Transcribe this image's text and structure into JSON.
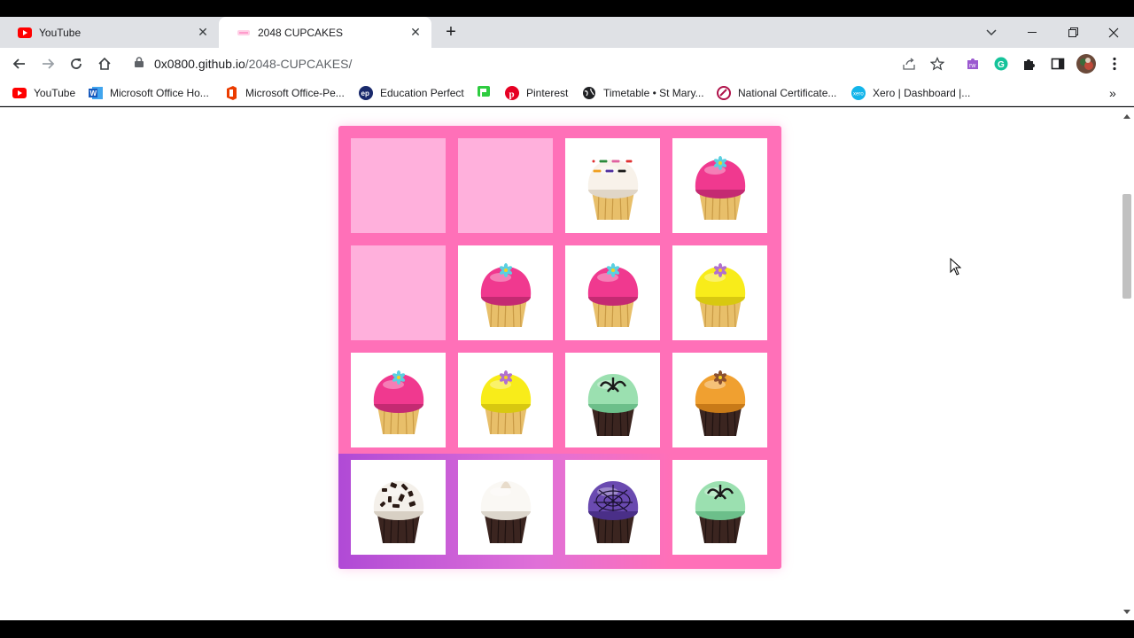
{
  "browser": {
    "tabs": [
      {
        "title": "YouTube",
        "icon": "youtube-icon",
        "active": false
      },
      {
        "title": "2048 CUPCAKES",
        "icon": "cupcakes-favicon",
        "active": true
      }
    ],
    "url_host": "0x0800.github.io",
    "url_path": "/2048-CUPCAKES/",
    "bookmarks": [
      {
        "label": "YouTube",
        "icon": "youtube-icon"
      },
      {
        "label": "Microsoft Office Ho...",
        "icon": "word-icon"
      },
      {
        "label": "Microsoft Office-Pe...",
        "icon": "office-icon"
      },
      {
        "label": "Education Perfect",
        "icon": "ep-icon"
      },
      {
        "label": "",
        "icon": "green-flag-icon"
      },
      {
        "label": "Pinterest",
        "icon": "pinterest-icon"
      },
      {
        "label": "Timetable • St Mary...",
        "icon": "globe-icon"
      },
      {
        "label": "National Certificate...",
        "icon": "nzqa-icon"
      },
      {
        "label": "Xero | Dashboard |...",
        "icon": "xero-icon"
      }
    ],
    "more_bookmarks": "»"
  },
  "game": {
    "title": "2048 CUPCAKES",
    "tiles": [
      "empty",
      "empty",
      "sprinkle-white",
      "pink-flower",
      "empty-faint",
      "pink-flower",
      "pink-flower",
      "yellow-flower",
      "pink-flower",
      "yellow-flower",
      "mint-chocolate",
      "orange-chocolate",
      "cookies-cream",
      "white-swirl-chocolate",
      "purple-web-chocolate",
      "mint-chocolate"
    ]
  },
  "colors": {
    "board": "#ff70b8",
    "empty_cell": "#ffb0dc",
    "board_glow": "#b04ad6"
  }
}
